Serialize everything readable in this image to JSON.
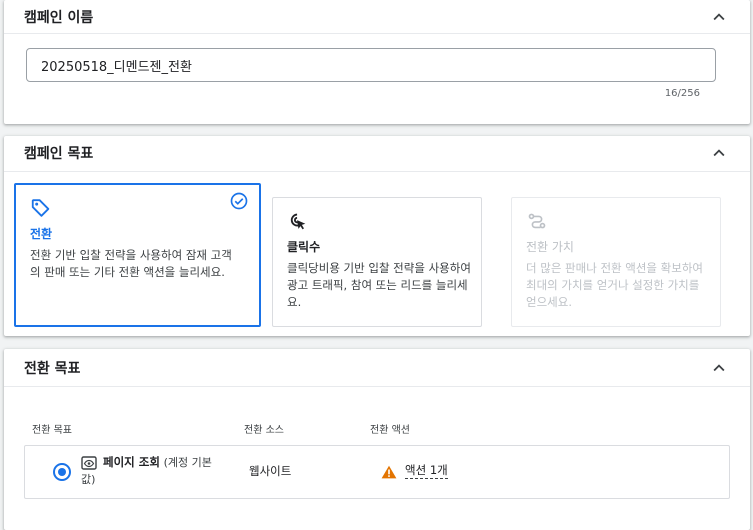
{
  "campaign_name": {
    "title": "캠페인 이름",
    "value": "20250518_디멘드젠_전환",
    "char_count": "16/256",
    "collapse_icon": "chevron-up-icon"
  },
  "campaign_goal": {
    "title": "캠페인 목표",
    "collapse_icon": "chevron-up-icon",
    "tiles": [
      {
        "title": "전환",
        "description": "전환 기반 입찰 전략을 사용하여 잠재 고객의 판매 또는 기타 전환 액션을 늘리세요.",
        "icon": "tag-icon",
        "selected": true
      },
      {
        "title": "클릭수",
        "description": "클릭당비용 기반 입찰 전략을 사용하여 광고 트래픽, 참여 또는 리드를 늘리세요.",
        "icon": "cursor-click-icon",
        "selected": false
      },
      {
        "title": "전환 가치",
        "description": "더 많은 판매나 전환 액션을 확보하여 최대의 가치를 얻거나 설정한 가치를 얻으세요.",
        "icon": "value-path-icon",
        "selected": false,
        "disabled": true
      }
    ]
  },
  "conversion_goals": {
    "title": "전환 목표",
    "collapse_icon": "chevron-up-icon",
    "columns": [
      "전환 목표",
      "전환 소스",
      "전환 액션"
    ],
    "rows": [
      {
        "name": "페이지 조회",
        "name_suffix": "(계정 기본값)",
        "source": "웹사이트",
        "action": "액션 1개",
        "selected": true
      }
    ]
  },
  "colors": {
    "accent": "#1a73e8",
    "warning": "#e37400",
    "disabled": "#bdc1c6"
  }
}
